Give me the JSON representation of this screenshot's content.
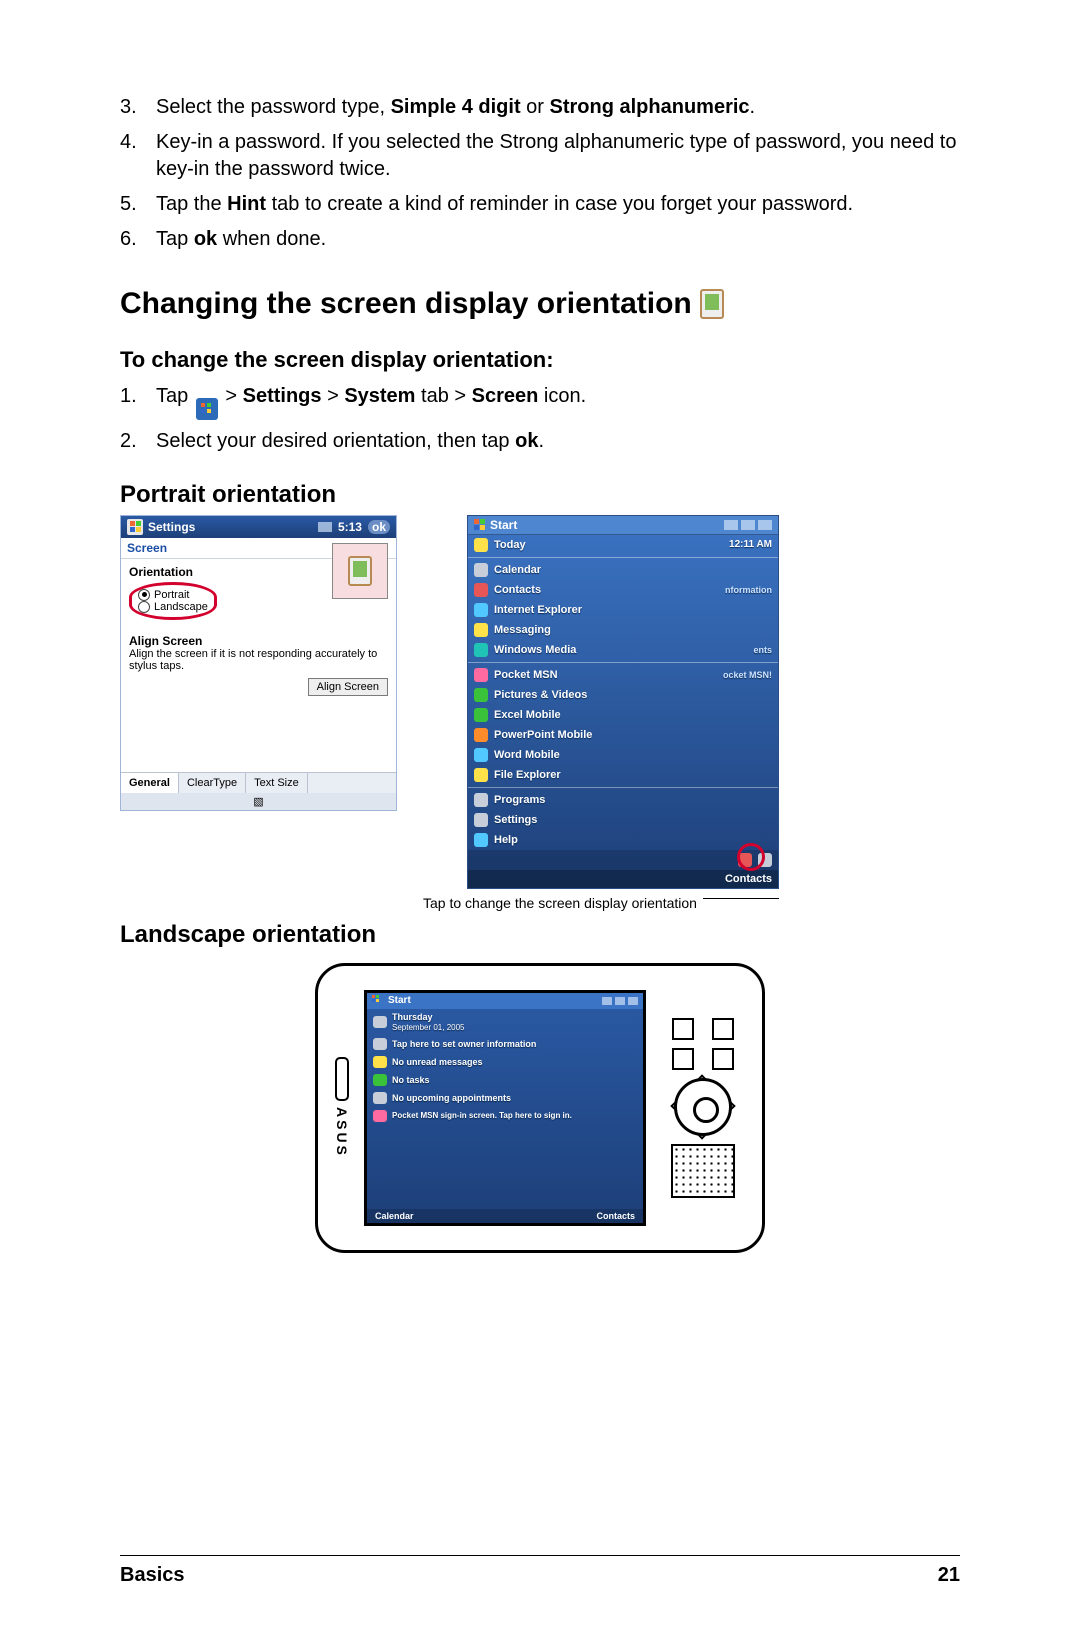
{
  "steps_password": {
    "s3": {
      "num": "3.",
      "text_a": "Select the password type, ",
      "b1": "Simple 4 digit",
      "mid": " or ",
      "b2": "Strong alphanumeric",
      "end": "."
    },
    "s4": {
      "num": "4.",
      "text": "Key-in a password. If you selected the Strong alphanumeric type of password, you need to key-in the password twice."
    },
    "s5": {
      "num": "5.",
      "text_a": "Tap the ",
      "b": "Hint",
      "text_b": " tab to create a kind of reminder in case you forget your password."
    },
    "s6": {
      "num": "6.",
      "text_a": "Tap ",
      "b": "ok",
      "text_b": " when done."
    }
  },
  "heading_orientation": "Changing the screen display orientation",
  "sub_to_change": "To change the screen display orientation:",
  "steps_orient": {
    "s1": {
      "num": "1.",
      "a": "Tap ",
      "b1": "Settings ",
      "gt1": "> ",
      "b2": "System ",
      "plain": "tab ",
      "gt2": "> ",
      "b3": "Screen ",
      "tail": "icon."
    },
    "s2": {
      "num": "2.",
      "a": "Select your desired orientation, then tap ",
      "b": "ok",
      "end": "."
    }
  },
  "portrait_head": "Portrait orientation",
  "landscape_head": "Landscape orientation",
  "portrait_shot": {
    "title": "Settings",
    "time": "5:13",
    "ok": "ok",
    "screen": "Screen",
    "orientation_label": "Orientation",
    "radio_portrait": "Portrait",
    "radio_landscape": "Landscape",
    "align_head": "Align Screen",
    "align_desc": "Align the screen if it is not responding accurately to stylus taps.",
    "align_btn": "Align Screen",
    "tab_general": "General",
    "tab_cleartype": "ClearType",
    "tab_textsize": "Text Size"
  },
  "start_shot": {
    "title": "Start",
    "clock": "12:11 AM",
    "items": [
      "Today",
      "Calendar",
      "Contacts",
      "Internet Explorer",
      "Messaging",
      "Windows Media",
      "Pocket MSN",
      "Pictures & Videos",
      "Excel Mobile",
      "PowerPoint Mobile",
      "Word Mobile",
      "File Explorer"
    ],
    "shortcuts": [
      "Programs",
      "Settings",
      "Help"
    ],
    "side_labels": [
      "nformation",
      "ents",
      "ocket MSN!"
    ],
    "bottom_right": "Contacts"
  },
  "callout": "Tap to change the screen display orientation",
  "device_screen": {
    "title": "Start",
    "day": "Thursday",
    "date": "September 01, 2005",
    "lines": [
      "Tap here to set owner information",
      "No unread messages",
      "No tasks",
      "No upcoming appointments",
      "Pocket MSN sign-in screen. Tap here to sign in."
    ],
    "bottom_left": "Calendar",
    "bottom_right": "Contacts"
  },
  "footer": {
    "left": "Basics",
    "right": "21"
  }
}
